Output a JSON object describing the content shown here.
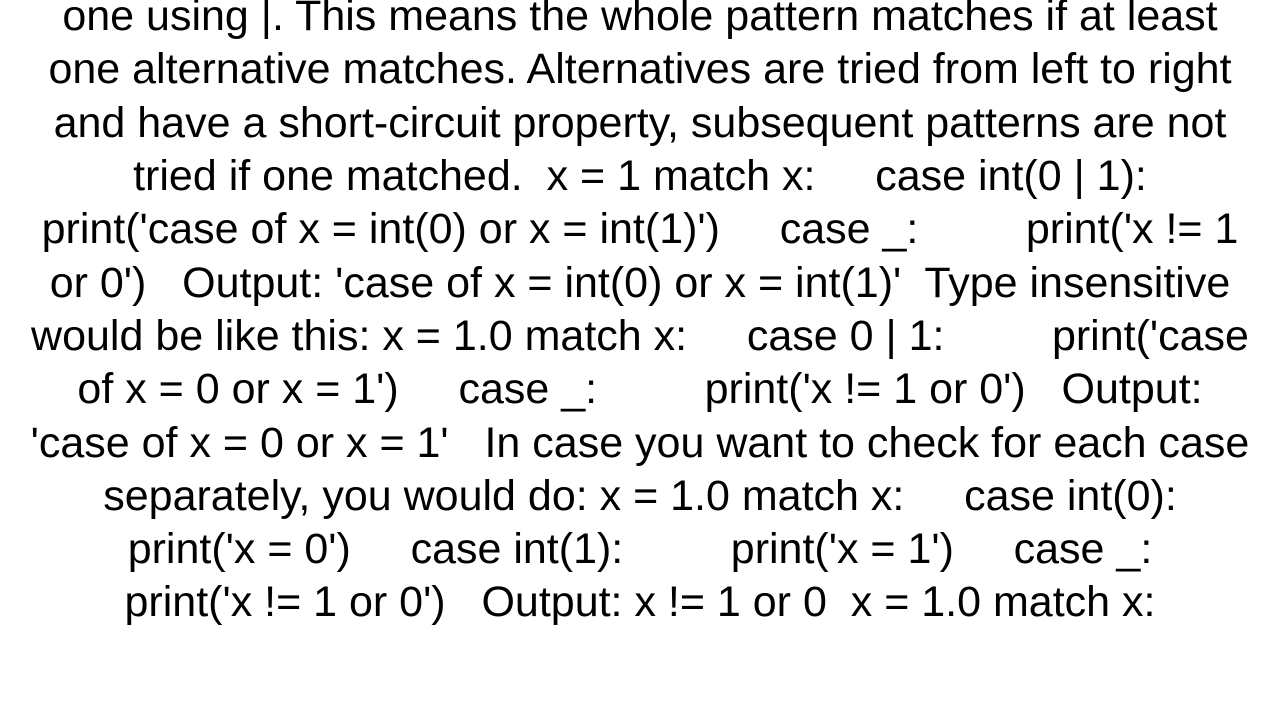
{
  "content": {
    "body": "one using |. This means the whole pattern matches if at least one alternative matches. Alternatives are tried from left to right and have a short-circuit property, subsequent patterns are not tried if one matched.  x = 1 match x:     case int(0 | 1):         print('case of x = int(0) or x = int(1)')     case _:         print('x != 1 or 0')   Output: 'case of x = int(0) or x = int(1)'  Type insensitive would be like this: x = 1.0 match x:     case 0 | 1:         print('case of x = 0 or x = 1')     case _:         print('x != 1 or 0')   Output: 'case of x = 0 or x = 1'   In case you want to check for each case separately, you would do: x = 1.0 match x:     case int(0):         print('x = 0')     case int(1):         print('x = 1')     case _:         print('x != 1 or 0')   Output: x != 1 or 0  x = 1.0 match x:"
  }
}
